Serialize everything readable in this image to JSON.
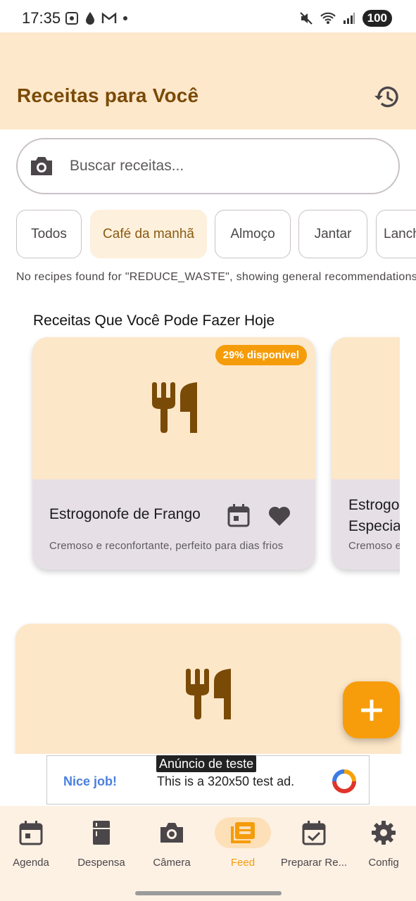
{
  "status_bar": {
    "time": "17:35",
    "battery": "100"
  },
  "header": {
    "title": "Receitas para Você"
  },
  "search": {
    "placeholder": "Buscar receitas..."
  },
  "chips": [
    "Todos",
    "Café da manhã",
    "Almoço",
    "Jantar",
    "Lanche"
  ],
  "selected_chip": "Café da manhã",
  "notice": "No recipes found for \"REDUCE_WASTE\", showing general recommendations",
  "section": {
    "title": "Receitas Que Você Pode Fazer Hoje"
  },
  "cards": [
    {
      "badge": "29% disponível",
      "name": "Estrogonofe de Frango",
      "description": "Cremoso e reconfortante, perfeito para dias frios"
    },
    {
      "name": "Estrogonofe Especial",
      "description": "Cremoso e reconfortante"
    }
  ],
  "ad": {
    "label": "Anúncio de teste",
    "nice": "Nice job!",
    "text": "This is a 320x50 test ad."
  },
  "nav": [
    {
      "label": "Agenda",
      "icon": "calendar-icon"
    },
    {
      "label": "Despensa",
      "icon": "fridge-icon"
    },
    {
      "label": "Câmera",
      "icon": "camera-icon"
    },
    {
      "label": "Feed",
      "icon": "feed-icon"
    },
    {
      "label": "Preparar Re...",
      "icon": "calendar-check-icon"
    },
    {
      "label": "Config",
      "icon": "gear-icon"
    }
  ],
  "active_nav": "Feed",
  "colors": {
    "accent": "#f59c0a",
    "header_bg": "#fde8cc",
    "title": "#7a4a07",
    "utensil": "#7a4a07",
    "card_bg": "#e6e0e6"
  }
}
